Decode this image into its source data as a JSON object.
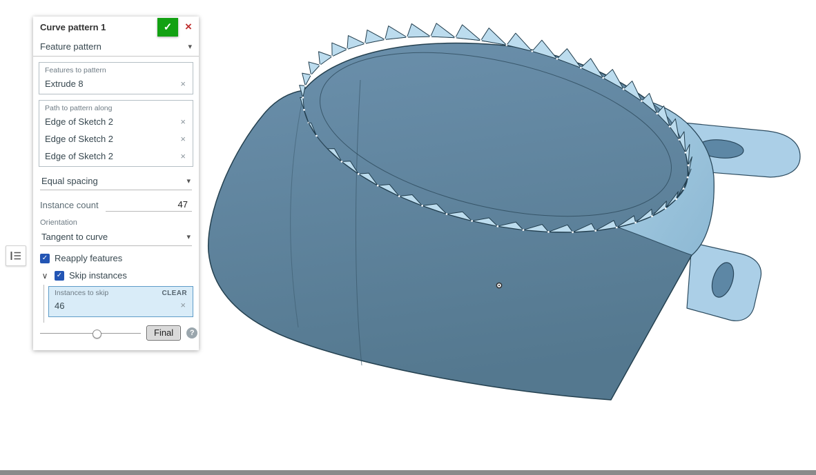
{
  "panel": {
    "title": "Curve pattern 1",
    "pattern_type": {
      "value": "Feature pattern"
    },
    "features": {
      "label": "Features to pattern",
      "items": [
        {
          "name": "Extrude 8"
        }
      ]
    },
    "path": {
      "label": "Path to pattern along",
      "items": [
        {
          "name": "Edge of Sketch 2"
        },
        {
          "name": "Edge of Sketch 2"
        },
        {
          "name": "Edge of Sketch 2"
        }
      ]
    },
    "spacing": {
      "value": "Equal spacing"
    },
    "instance_count": {
      "label": "Instance count",
      "value": "47"
    },
    "orientation": {
      "label": "Orientation",
      "value": "Tangent to curve"
    },
    "reapply": {
      "label": "Reapply features",
      "checked": true
    },
    "skip": {
      "label": "Skip instances",
      "checked": true
    },
    "skip_list": {
      "label": "Instances to skip",
      "clear": "CLEAR",
      "value": "46"
    },
    "footer": {
      "final": "Final",
      "help": "?"
    }
  },
  "icons": {
    "check": "✓",
    "close": "×",
    "caret": "▾",
    "chevron": "∨",
    "remove": "×"
  },
  "model": {
    "instance_count": 47,
    "skipped_instances": [
      46
    ],
    "teeth_visible": 46
  },
  "colors": {
    "accept_green": "#12a112",
    "cancel_red": "#c03030",
    "checkbox_blue": "#2355b4",
    "skip_highlight_bg": "#d9ecf8",
    "body_fill": "#5d82a0",
    "rim_teeth": "#bcdcee",
    "tab_fill": "#abcfe7",
    "edge_dark": "#24404f"
  }
}
